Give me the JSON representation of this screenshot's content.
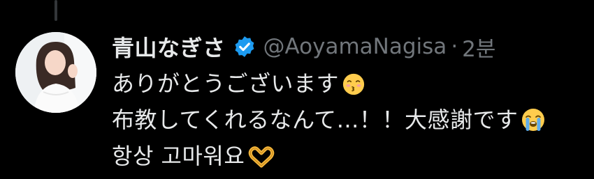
{
  "tweet": {
    "display_name": "青山なぎさ",
    "verified_icon": "verified-badge-icon",
    "handle": "@AoyamaNagisa",
    "separator": "·",
    "time": "2분",
    "lines": [
      {
        "text": "ありがとうございます",
        "emoji": "kissing-face-closed-eyes-icon"
      },
      {
        "text": "布教してくれるなんて…！！大感謝です",
        "emoji": "loudly-crying-face-icon"
      },
      {
        "text": "항상 고마워요",
        "emoji": "heart-hands-icon"
      }
    ]
  },
  "colors": {
    "background": "#000000",
    "text_primary": "#e7e9ea",
    "text_secondary": "#71767b",
    "verified_blue": "#1d9bf0",
    "thread_line": "#333639"
  }
}
